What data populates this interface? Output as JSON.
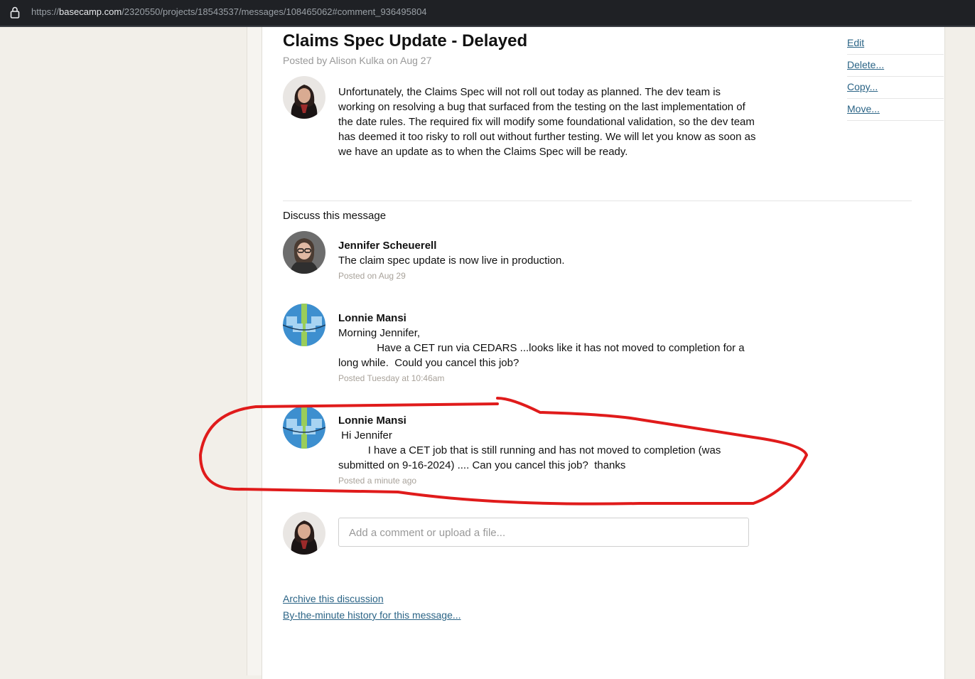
{
  "browser": {
    "url_prefix": "https://",
    "url_domain": "basecamp.com",
    "url_path": "/2320550/projects/18543537/messages/108465062#comment_936495804"
  },
  "message": {
    "title": "Claims Spec Update - Delayed",
    "byline": "Posted by Alison Kulka on Aug 27",
    "body": "Unfortunately, the Claims Spec will not roll out today as planned. The dev team is working on resolving a bug that surfaced from the testing on the last implementation of the date rules. The required fix will modify some foundational validation, so the dev team has deemed it too risky to roll out without further testing. We will let you know as soon as we have an update as to when the Claims Spec will be ready."
  },
  "side_menu": {
    "edit": "Edit",
    "delete": "Delete...",
    "copy": "Copy...",
    "move": "Move..."
  },
  "discussion": {
    "heading": "Discuss this message",
    "comments": [
      {
        "author": "Jennifer Scheuerell",
        "text": "The claim spec update is now live in production.",
        "time": "Posted on Aug 29"
      },
      {
        "author": "Lonnie Mansi",
        "text": "Morning Jennifer,\n             Have a CET run via CEDARS ...looks like it has not moved to completion for a long while.  Could you cancel this job?",
        "time": "Posted Tuesday at 10:46am"
      },
      {
        "author": "Lonnie Mansi",
        "text": " Hi Jennifer\n          I have a CET job that is still running and has not moved to completion (was submitted on 9-16-2024) .... Can you cancel this job?  thanks",
        "time": "Posted a minute ago"
      }
    ],
    "input_placeholder": "Add a comment or upload a file..."
  },
  "footer": {
    "archive": "Archive this discussion",
    "history": "By-the-minute history for this message..."
  },
  "colors": {
    "link": "#2b6486",
    "annotation": "#e01b1b"
  }
}
